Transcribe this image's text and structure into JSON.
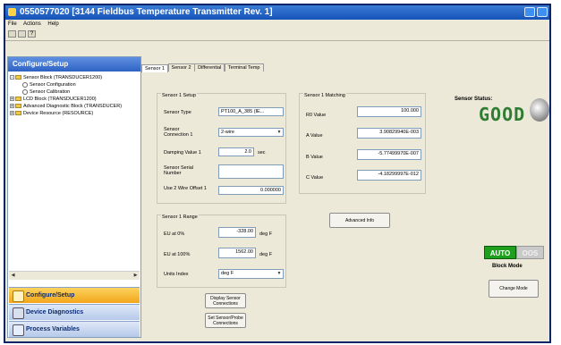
{
  "window": {
    "title": "0550577020 [3144 Fieldbus Temperature Transmitter Rev. 1]"
  },
  "menu": [
    "File",
    "Actions",
    "Help"
  ],
  "sidebar": {
    "header": "Configure/Setup",
    "tree": [
      {
        "label": "Sensor Block (TRANSDUCER1200)",
        "type": "folder",
        "expander": "-"
      },
      {
        "label": "Sensor Configuration",
        "type": "gear"
      },
      {
        "label": "Sensor Calibration",
        "type": "gear"
      },
      {
        "label": "LCD Block (TRANSDUCER1200)",
        "type": "folder",
        "expander": "+"
      },
      {
        "label": "Advanced Diagnostic Block (TRANSDUCER)",
        "type": "folder",
        "expander": "+"
      },
      {
        "label": "Device Resource (RESOURCE)",
        "type": "folder",
        "expander": "+"
      }
    ],
    "nav": [
      {
        "label": "Configure/Setup",
        "active": true
      },
      {
        "label": "Device Diagnostics",
        "active": false
      },
      {
        "label": "Process Variables",
        "active": false
      }
    ]
  },
  "tabs": [
    "Sensor 1",
    "Sensor 2",
    "Differential",
    "Terminal Temp"
  ],
  "sensor_setup": {
    "title": "Sensor 1 Setup",
    "sensor_type_label": "Sensor Type",
    "sensor_type_value": "PT100_A_385 (IE...",
    "connection_label": "Sensor Connection 1",
    "connection_value": "2-wire",
    "damping_label": "Damping Value 1",
    "damping_value": "2.0",
    "damping_unit": "sec",
    "serial_label": "Sensor Serial Number",
    "serial_value": "",
    "offset_label": "Use 2 Wire Offset 1",
    "offset_value": "0.000000"
  },
  "sensor_range": {
    "title": "Sensor 1 Range",
    "eu0_label": "EU at 0%",
    "eu0_value": "-328.00",
    "eu0_unit": "deg F",
    "eu100_label": "EU at 100%",
    "eu100_value": "1562.00",
    "eu100_unit": "deg F",
    "units_label": "Units Index",
    "units_value": "deg F"
  },
  "sensor_matching": {
    "title": "Sensor 1 Matching",
    "r0_label": "R0 Value",
    "r0_value": "100.000",
    "a_label": "A Value",
    "a_value": "3.90829940E-003",
    "b_label": "B Value",
    "b_value": "-5.77499970E-007",
    "c_label": "C Value",
    "c_value": "-4.18299997E-012"
  },
  "buttons": {
    "advanced_info": "Advanced Info",
    "display_connections": "Display Sensor Connections",
    "set_connections": "Set Sensor/Probe Connections",
    "change_mode": "Change Mode"
  },
  "status": {
    "label": "Sensor Status:",
    "value": "GOOD",
    "value_color": "#2e7d32"
  },
  "block_mode": {
    "auto_label": "AUTO",
    "oos_label": "OOS",
    "title": "Block Mode",
    "active": "AUTO"
  }
}
